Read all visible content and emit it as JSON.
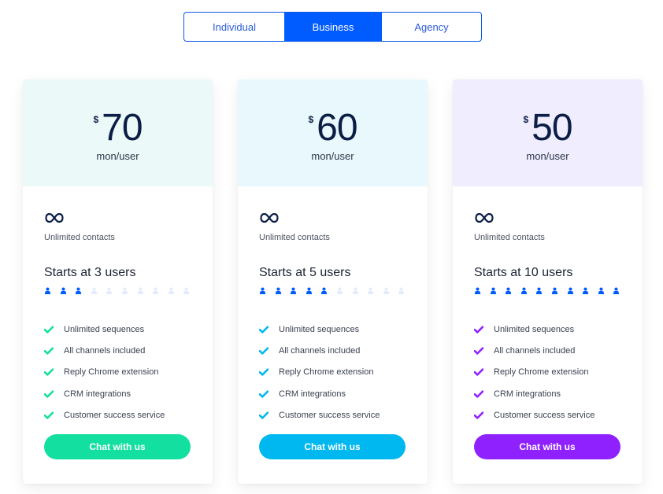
{
  "plan_toggle": {
    "tabs": [
      {
        "label": "Individual",
        "active": false
      },
      {
        "label": "Business",
        "active": true
      },
      {
        "label": "Agency",
        "active": false
      }
    ]
  },
  "plans": [
    {
      "currency": "$",
      "price": "70",
      "period": "mon/user",
      "header_bg": "#ebfaf8",
      "accent": "#13e0a0",
      "contacts_icon": "infinity-icon",
      "contacts_label": "Unlimited contacts",
      "starts_label": "Starts at 3 users",
      "users_active": 3,
      "users_total": 10,
      "check_icon": "check-icon",
      "features": [
        "Unlimited sequences",
        "All channels included",
        "Reply Chrome extension",
        "CRM integrations",
        "Customer success service"
      ],
      "cta_label": "Chat with us"
    },
    {
      "currency": "$",
      "price": "60",
      "period": "mon/user",
      "header_bg": "#e9f8fd",
      "accent": "#00b8f0",
      "contacts_icon": "infinity-icon",
      "contacts_label": "Unlimited contacts",
      "starts_label": "Starts at 5 users",
      "users_active": 5,
      "users_total": 10,
      "check_icon": "check-icon",
      "features": [
        "Unlimited sequences",
        "All channels included",
        "Reply Chrome extension",
        "CRM integrations",
        "Customer success service"
      ],
      "cta_label": "Chat with us"
    },
    {
      "currency": "$",
      "price": "50",
      "period": "mon/user",
      "header_bg": "#efedfe",
      "accent": "#8f21ff",
      "contacts_icon": "infinity-icon",
      "contacts_label": "Unlimited contacts",
      "starts_label": "Starts at 10 users",
      "users_active": 10,
      "users_total": 10,
      "check_icon": "check-icon",
      "features": [
        "Unlimited sequences",
        "All channels included",
        "Reply Chrome extension",
        "CRM integrations",
        "Customer success service"
      ],
      "cta_label": "Chat with us"
    }
  ],
  "colors": {
    "primary_blue": "#005cff",
    "user_active": "#005cff",
    "user_inactive": "#e3ecfb",
    "text_dark": "#0c1e45"
  }
}
